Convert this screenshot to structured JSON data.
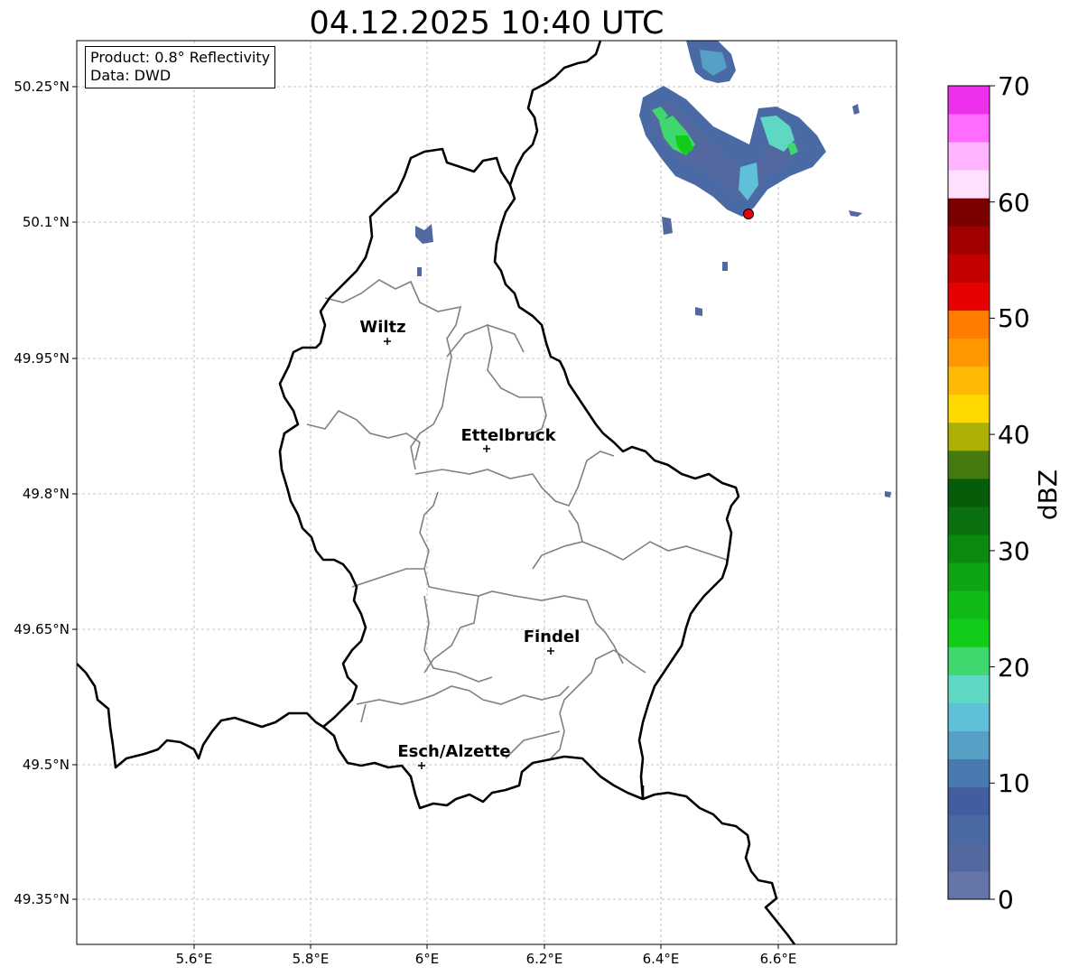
{
  "title": "04.12.2025 10:40 UTC",
  "info_box": {
    "line1": "Product: 0.8° Reflectivity",
    "line2": "Data: DWD"
  },
  "axes": {
    "lon_ticks": [
      "5.6°E",
      "5.8°E",
      "6°E",
      "6.2°E",
      "6.4°E",
      "6.6°E"
    ],
    "lat_ticks": [
      "50.25°N",
      "50.1°N",
      "49.95°N",
      "49.8°N",
      "49.65°N",
      "49.5°N",
      "49.35°N"
    ],
    "grid": true
  },
  "cities": [
    {
      "name": "Wiltz"
    },
    {
      "name": "Ettelbruck"
    },
    {
      "name": "Findel"
    },
    {
      "name": "Esch/Alzette"
    }
  ],
  "radar_site_color": "#e8000b",
  "colorbar": {
    "label": "dBZ",
    "ticks": [
      "0",
      "10",
      "20",
      "30",
      "40",
      "50",
      "60",
      "70"
    ],
    "colors": [
      "#6675a8",
      "#5468a0",
      "#4a6aa6",
      "#425ea0",
      "#4a78b0",
      "#56a0c6",
      "#60c0d8",
      "#5ed8c2",
      "#3ed86e",
      "#12cc1a",
      "#10bb18",
      "#0ea414",
      "#0c8a10",
      "#0a7010",
      "#065c08",
      "#447a10",
      "#acb004",
      "#ffd800",
      "#ffb804",
      "#ff9800",
      "#ff7c00",
      "#e60000",
      "#c30000",
      "#a00000",
      "#7a0000",
      "#ffe0ff",
      "#ffb4ff",
      "#ff6cff",
      "#ec30ec"
    ]
  }
}
